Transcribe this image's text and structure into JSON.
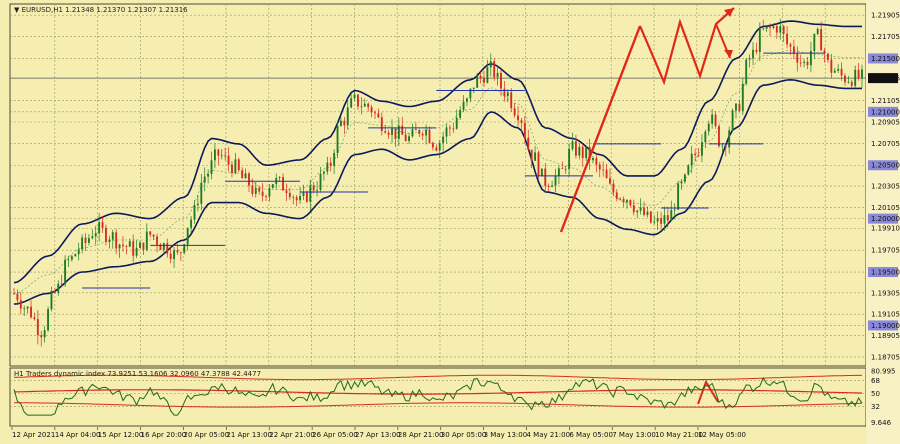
{
  "window": {
    "title": "EURUSD,H1",
    "ohlc": "1.21348 1.21370 1.21307 1.21316"
  },
  "indicator": {
    "label": "H1 Traders dynamic index 73.9251 53.1606 32.0960 47.3788 42.4477"
  },
  "chart_data": {
    "type": "candlestick",
    "symbol": "EURUSD",
    "timeframe": "H1",
    "current_price": "1.21316",
    "y_ticks": [
      "1.21905",
      "1.21705",
      "1.21500",
      "1.21316",
      "1.21105",
      "1.21000",
      "1.20905",
      "1.20705",
      "1.20500",
      "1.20305",
      "1.20105",
      "1.20000",
      "1.19910",
      "1.19705",
      "1.19500",
      "1.19305",
      "1.19105",
      "1.19000",
      "1.18905",
      "1.18705"
    ],
    "highlighted_levels": [
      "1.21500",
      "1.21000",
      "1.20500",
      "1.20000",
      "1.19500",
      "1.19000"
    ],
    "ylim": [
      1.1862,
      1.2201
    ],
    "x_ticks": [
      "12 Apr 2021",
      "14 Apr 04:00",
      "15 Apr 12:00",
      "16 Apr 20:00",
      "20 Apr 05:00",
      "21 Apr 13:00",
      "22 Apr 21:00",
      "26 Apr 05:00",
      "27 Apr 13:00",
      "28 Apr 21:00",
      "30 Apr 05:00",
      "3 May 13:00",
      "4 May 21:00",
      "6 May 05:00",
      "7 May 13:00",
      "10 May 21:00",
      "12 May 05:00"
    ],
    "close_path": [
      [
        0,
        1.193
      ],
      [
        4,
        1.1915
      ],
      [
        8,
        1.1895
      ],
      [
        12,
        1.193
      ],
      [
        16,
        1.196
      ],
      [
        20,
        1.1975
      ],
      [
        24,
        1.199
      ],
      [
        28,
        1.1985
      ],
      [
        32,
        1.1975
      ],
      [
        36,
        1.197
      ],
      [
        40,
        1.1985
      ],
      [
        44,
        1.1975
      ],
      [
        48,
        1.1965
      ],
      [
        52,
        1.2
      ],
      [
        56,
        1.204
      ],
      [
        60,
        1.206
      ],
      [
        64,
        1.205
      ],
      [
        68,
        1.2035
      ],
      [
        72,
        1.202
      ],
      [
        76,
        1.2035
      ],
      [
        80,
        1.203
      ],
      [
        84,
        1.2015
      ],
      [
        88,
        1.203
      ],
      [
        92,
        1.2045
      ],
      [
        96,
        1.209
      ],
      [
        100,
        1.211
      ],
      [
        104,
        1.2105
      ],
      [
        108,
        1.209
      ],
      [
        112,
        1.208
      ],
      [
        116,
        1.2075
      ],
      [
        120,
        1.2085
      ],
      [
        124,
        1.207
      ],
      [
        128,
        1.2085
      ],
      [
        132,
        1.2105
      ],
      [
        136,
        1.213
      ],
      [
        140,
        1.214
      ],
      [
        144,
        1.212
      ],
      [
        148,
        1.21
      ],
      [
        152,
        1.206
      ],
      [
        156,
        1.2035
      ],
      [
        160,
        1.204
      ],
      [
        164,
        1.2065
      ],
      [
        168,
        1.206
      ],
      [
        172,
        1.2045
      ],
      [
        176,
        1.2025
      ],
      [
        180,
        1.202
      ],
      [
        184,
        1.2005
      ],
      [
        188,
        1.1995
      ],
      [
        192,
        1.2
      ],
      [
        196,
        1.203
      ],
      [
        200,
        1.206
      ],
      [
        204,
        1.2095
      ],
      [
        208,
        1.207
      ],
      [
        212,
        1.21
      ],
      [
        216,
        1.215
      ],
      [
        220,
        1.2175
      ],
      [
        224,
        1.218
      ],
      [
        228,
        1.216
      ],
      [
        232,
        1.2145
      ],
      [
        236,
        1.217
      ],
      [
        240,
        1.214
      ],
      [
        244,
        1.2132
      ]
    ],
    "upper_band": [
      [
        0,
        1.194
      ],
      [
        10,
        1.1965
      ],
      [
        20,
        1.1995
      ],
      [
        30,
        1.2005
      ],
      [
        40,
        1.2
      ],
      [
        50,
        1.202
      ],
      [
        58,
        1.2075
      ],
      [
        66,
        1.207
      ],
      [
        74,
        1.205
      ],
      [
        84,
        1.2055
      ],
      [
        92,
        1.2075
      ],
      [
        100,
        1.212
      ],
      [
        108,
        1.211
      ],
      [
        116,
        1.2105
      ],
      [
        124,
        1.211
      ],
      [
        134,
        1.213
      ],
      [
        140,
        1.2145
      ],
      [
        148,
        1.213
      ],
      [
        156,
        1.2085
      ],
      [
        164,
        1.2075
      ],
      [
        172,
        1.206
      ],
      [
        180,
        1.204
      ],
      [
        188,
        1.204
      ],
      [
        196,
        1.2065
      ],
      [
        204,
        1.211
      ],
      [
        212,
        1.215
      ],
      [
        220,
        1.218
      ],
      [
        228,
        1.2185
      ],
      [
        236,
        1.2182
      ],
      [
        244,
        1.218
      ]
    ],
    "lower_band": [
      [
        0,
        1.192
      ],
      [
        10,
        1.193
      ],
      [
        20,
        1.195
      ],
      [
        30,
        1.1955
      ],
      [
        40,
        1.196
      ],
      [
        50,
        1.198
      ],
      [
        58,
        1.2015
      ],
      [
        66,
        1.2015
      ],
      [
        74,
        1.2005
      ],
      [
        84,
        1.2
      ],
      [
        92,
        1.202
      ],
      [
        100,
        1.206
      ],
      [
        108,
        1.2065
      ],
      [
        116,
        1.2055
      ],
      [
        124,
        1.206
      ],
      [
        134,
        1.2075
      ],
      [
        140,
        1.21
      ],
      [
        148,
        1.2085
      ],
      [
        156,
        1.2025
      ],
      [
        164,
        1.202
      ],
      [
        172,
        1.2
      ],
      [
        180,
        1.199
      ],
      [
        188,
        1.1985
      ],
      [
        196,
        1.2005
      ],
      [
        204,
        1.2035
      ],
      [
        212,
        1.2085
      ],
      [
        220,
        1.2125
      ],
      [
        228,
        1.213
      ],
      [
        236,
        1.2125
      ],
      [
        244,
        1.2122
      ]
    ],
    "indicator_ticks": [
      "80.995",
      "68",
      "50",
      "32",
      "9.646"
    ],
    "indicator_ylim": [
      5,
      85
    ],
    "indicator_levels": [
      68,
      50,
      32
    ]
  }
}
